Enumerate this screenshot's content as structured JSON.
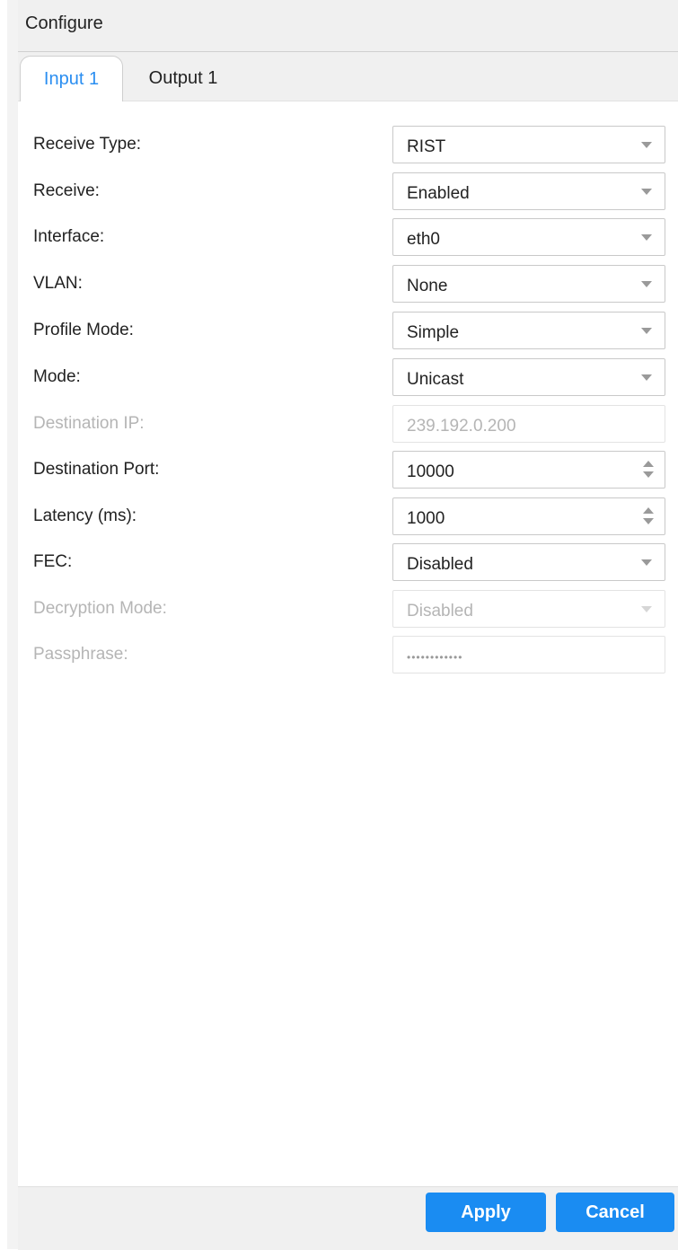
{
  "header": {
    "title": "Configure"
  },
  "tabs": [
    {
      "label": "Input 1",
      "active": true
    },
    {
      "label": "Output 1",
      "active": false
    }
  ],
  "fields": [
    {
      "label": "Receive Type:",
      "value": "RIST",
      "type": "select",
      "disabled": false
    },
    {
      "label": "Receive:",
      "value": "Enabled",
      "type": "select",
      "disabled": false
    },
    {
      "label": "Interface:",
      "value": "eth0",
      "type": "select",
      "disabled": false
    },
    {
      "label": "VLAN:",
      "value": "None",
      "type": "select",
      "disabled": false
    },
    {
      "label": "Profile Mode:",
      "value": "Simple",
      "type": "select",
      "disabled": false
    },
    {
      "label": "Mode:",
      "value": "Unicast",
      "type": "select",
      "disabled": false
    },
    {
      "label": "Destination IP:",
      "value": "239.192.0.200",
      "type": "text",
      "disabled": true
    },
    {
      "label": "Destination Port:",
      "value": "10000",
      "type": "number",
      "disabled": false
    },
    {
      "label": "Latency (ms):",
      "value": "1000",
      "type": "number",
      "disabled": false
    },
    {
      "label": "FEC:",
      "value": "Disabled",
      "type": "select",
      "disabled": false
    },
    {
      "label": "Decryption Mode:",
      "value": "Disabled",
      "type": "select",
      "disabled": true
    },
    {
      "label": "Passphrase:",
      "value": "••••••••••••",
      "type": "password",
      "disabled": true
    }
  ],
  "buttons": {
    "apply": "Apply",
    "cancel": "Cancel"
  },
  "colors": {
    "accent": "#1a8cf2",
    "active_tab_text": "#2a8ef1",
    "disabled_text": "#b5b5b5"
  }
}
